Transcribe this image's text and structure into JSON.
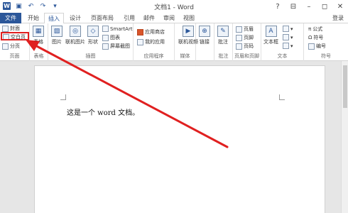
{
  "window": {
    "title": "文档1 - Word",
    "controls": [
      "?",
      "⊟",
      "–",
      "◻",
      "✕"
    ]
  },
  "tabs": {
    "file": "文件",
    "items": [
      "开始",
      "插入",
      "设计",
      "页面布局",
      "引用",
      "邮件",
      "审阅",
      "视图"
    ],
    "active": "插入",
    "login": "登录"
  },
  "ribbon": {
    "pages": {
      "label": "页面",
      "cover": "封面",
      "blank": "空白页",
      "break": "分页"
    },
    "table": {
      "label": "表格",
      "btn": "表格"
    },
    "illustrations": {
      "label": "插图",
      "picture": "图片",
      "online_picture": "联机图片",
      "shapes": "形状",
      "smartart": "SmartArt",
      "chart": "图表",
      "screenshot": "屏幕截图"
    },
    "apps": {
      "label": "应用程序",
      "store": "应用商店",
      "my_apps": "我的应用"
    },
    "media": {
      "label": "媒体",
      "online_video": "联机视频"
    },
    "links": {
      "btn": "链接"
    },
    "comments": {
      "label": "批注",
      "btn": "批注"
    },
    "header_footer": {
      "label": "页眉和页脚",
      "header": "页眉",
      "footer": "页脚",
      "page_number": "页码"
    },
    "text": {
      "label": "文本",
      "textbox": "文本框"
    },
    "symbols": {
      "label": "符号",
      "equation": "公式",
      "symbol": "符号",
      "number": "编号"
    }
  },
  "document": {
    "body_text": "这是一个 word 文档。"
  },
  "annotation": {
    "arrow_color": "#e02020"
  }
}
